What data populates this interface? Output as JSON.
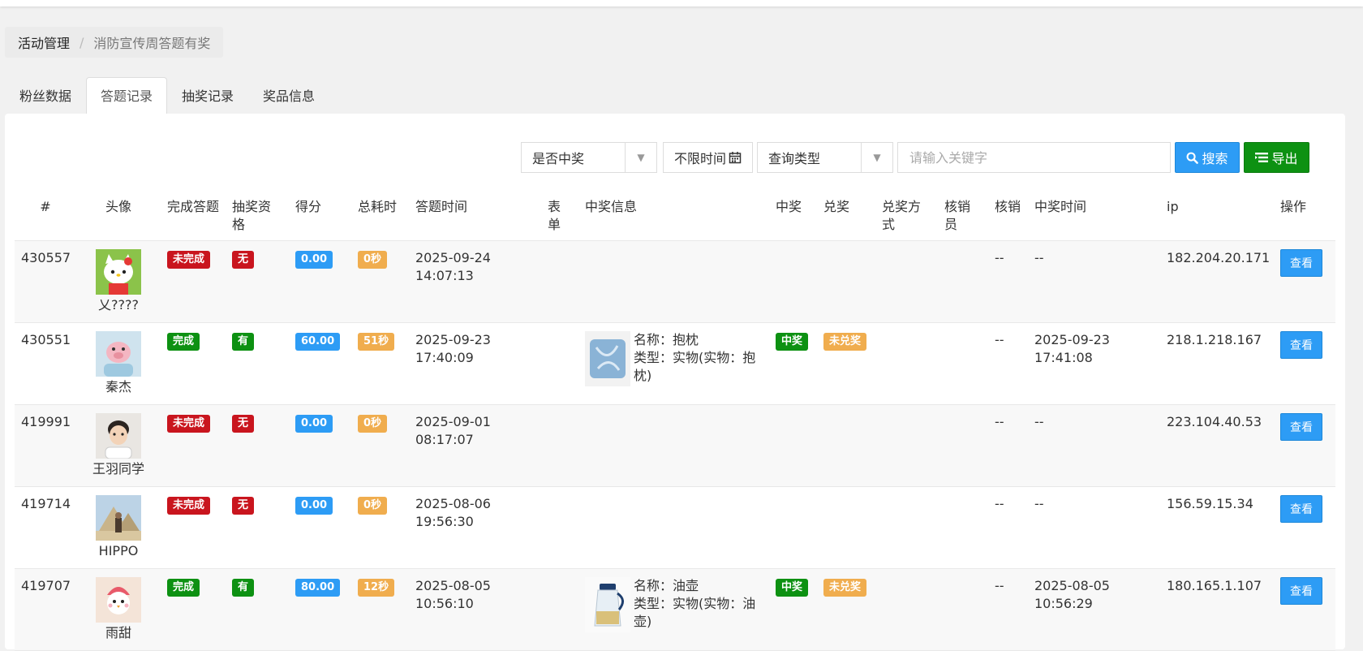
{
  "breadcrumb": {
    "parent": "活动管理",
    "separator": "/",
    "current": "消防宣传周答题有奖"
  },
  "tabs": [
    {
      "label": "粉丝数据",
      "active": false
    },
    {
      "label": "答题记录",
      "active": true
    },
    {
      "label": "抽奖记录",
      "active": false
    },
    {
      "label": "奖品信息",
      "active": false
    }
  ],
  "filters": {
    "prize_select": "是否中奖",
    "time_button": "不限时间",
    "query_type_select": "查询类型",
    "keyword_placeholder": "请输入关键字",
    "search_label": "搜索",
    "export_label": "导出"
  },
  "columns": [
    "#",
    "头像",
    "完成答题",
    "抽奖资格",
    "得分",
    "总耗时",
    "答题时间",
    "表单",
    "中奖信息",
    "中奖",
    "兑奖",
    "兑奖方式",
    "核销员",
    "核销",
    "中奖时间",
    "ip",
    "操作"
  ],
  "rows": [
    {
      "id": "430557",
      "avatar": "hello-kitty",
      "name": "乂????",
      "complete": "未完成",
      "qualified": "无",
      "score": "0.00",
      "duration": "0秒",
      "answer_date": "2025-09-24",
      "answer_time": "14:07:13",
      "prize": null,
      "won": "",
      "redeem": "",
      "verify": "--",
      "win_date": "--",
      "win_time": "",
      "ip": "182.204.20.171",
      "action": "查看"
    },
    {
      "id": "430551",
      "avatar": "pink-pig",
      "name": "秦杰",
      "complete": "完成",
      "qualified": "有",
      "score": "60.00",
      "duration": "51秒",
      "answer_date": "2025-09-23",
      "answer_time": "17:40:09",
      "prize": {
        "thumb": "pillow",
        "name": "名称：抱枕",
        "type": "类型：实物(实物：抱枕)"
      },
      "won": "中奖",
      "redeem": "未兑奖",
      "verify": "--",
      "win_date": "2025-09-23",
      "win_time": "17:41:08",
      "ip": "218.1.218.167",
      "action": "查看"
    },
    {
      "id": "419991",
      "avatar": "child-photo",
      "name": "王羽同学",
      "complete": "未完成",
      "qualified": "无",
      "score": "0.00",
      "duration": "0秒",
      "answer_date": "2025-09-01",
      "answer_time": "08:17:07",
      "prize": null,
      "won": "",
      "redeem": "",
      "verify": "--",
      "win_date": "--",
      "win_time": "",
      "ip": "223.104.40.53",
      "action": "查看"
    },
    {
      "id": "419714",
      "avatar": "pyramid-photo",
      "name": "HIPPO",
      "complete": "未完成",
      "qualified": "无",
      "score": "0.00",
      "duration": "0秒",
      "answer_date": "2025-08-06",
      "answer_time": "19:56:30",
      "prize": null,
      "won": "",
      "redeem": "",
      "verify": "--",
      "win_date": "--",
      "win_time": "",
      "ip": "156.59.15.34",
      "action": "查看"
    },
    {
      "id": "419707",
      "avatar": "strawberry-bird",
      "name": "雨甜",
      "complete": "完成",
      "qualified": "有",
      "score": "80.00",
      "duration": "12秒",
      "answer_date": "2025-08-05",
      "answer_time": "10:56:10",
      "prize": {
        "thumb": "oil-pot",
        "name": "名称：油壶",
        "type": "类型：实物(实物：油壶)"
      },
      "won": "中奖",
      "redeem": "未兑奖",
      "verify": "--",
      "win_date": "2025-08-05",
      "win_time": "10:56:29",
      "ip": "180.165.1.107",
      "action": "查看"
    }
  ],
  "colors": {
    "red": "#c9151e",
    "green": "#0d9112",
    "blue": "#2d9cf5",
    "orange": "#f0ad4e"
  }
}
